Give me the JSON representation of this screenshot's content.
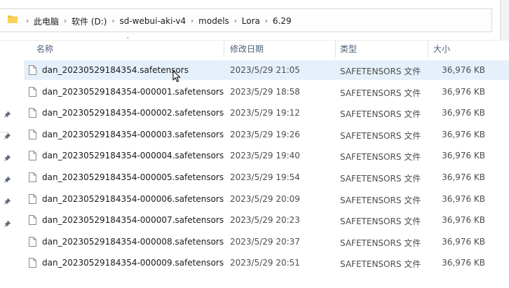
{
  "breadcrumb": {
    "items": [
      "此电脑",
      "软件 (D:)",
      "sd-webui-aki-v4",
      "models",
      "Lora",
      "6.29"
    ]
  },
  "columns": {
    "name": "名称",
    "date": "修改日期",
    "type": "类型",
    "size": "大小"
  },
  "files": [
    {
      "name": "dan_20230529184354.safetensors",
      "date": "2023/5/29 21:05",
      "type": "SAFETENSORS 文件",
      "size": "36,976 KB",
      "selected": true
    },
    {
      "name": "dan_20230529184354-000001.safetensors",
      "date": "2023/5/29 18:58",
      "type": "SAFETENSORS 文件",
      "size": "36,976 KB"
    },
    {
      "name": "dan_20230529184354-000002.safetensors",
      "date": "2023/5/29 19:12",
      "type": "SAFETENSORS 文件",
      "size": "36,976 KB"
    },
    {
      "name": "dan_20230529184354-000003.safetensors",
      "date": "2023/5/29 19:26",
      "type": "SAFETENSORS 文件",
      "size": "36,976 KB"
    },
    {
      "name": "dan_20230529184354-000004.safetensors",
      "date": "2023/5/29 19:40",
      "type": "SAFETENSORS 文件",
      "size": "36,976 KB"
    },
    {
      "name": "dan_20230529184354-000005.safetensors",
      "date": "2023/5/29 19:54",
      "type": "SAFETENSORS 文件",
      "size": "36,976 KB"
    },
    {
      "name": "dan_20230529184354-000006.safetensors",
      "date": "2023/5/29 20:09",
      "type": "SAFETENSORS 文件",
      "size": "36,976 KB"
    },
    {
      "name": "dan_20230529184354-000007.safetensors",
      "date": "2023/5/29 20:23",
      "type": "SAFETENSORS 文件",
      "size": "36,976 KB"
    },
    {
      "name": "dan_20230529184354-000008.safetensors",
      "date": "2023/5/29 20:37",
      "type": "SAFETENSORS 文件",
      "size": "36,976 KB"
    },
    {
      "name": "dan_20230529184354-000009.safetensors",
      "date": "2023/5/29 20:51",
      "type": "SAFETENSORS 文件",
      "size": "36,976 KB"
    }
  ],
  "icons": {
    "folder": "folder-icon",
    "file": "file-icon",
    "pin": "pin-icon",
    "sort": "sort-up-icon",
    "cursor": "mouse-cursor-icon"
  },
  "colors": {
    "folder": "#f3c443",
    "selection": "#e6f0fb",
    "header_text": "#4c607a"
  }
}
